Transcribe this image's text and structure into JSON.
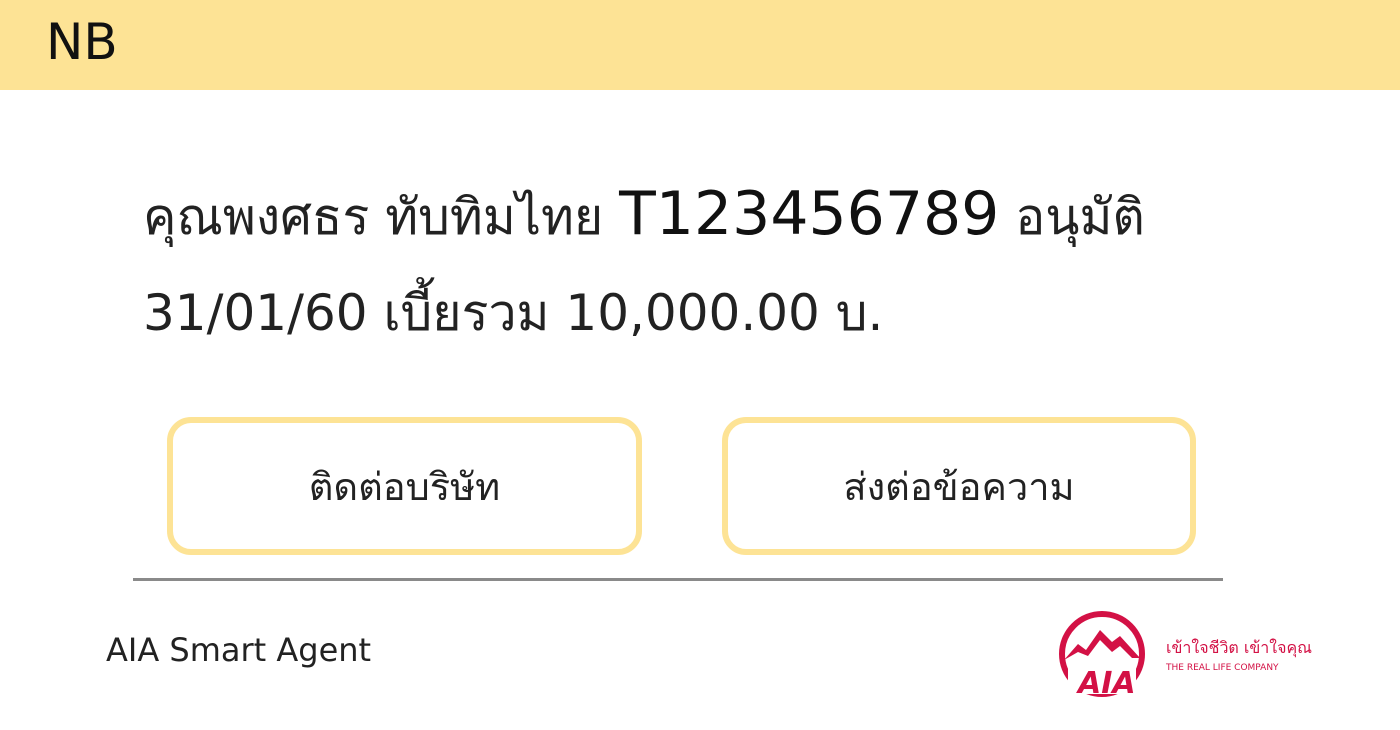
{
  "header": {
    "title": "NB"
  },
  "message": {
    "customer_name": "คุณพงศธร ทับทิมไทย",
    "policy_number": "T123456789",
    "status": "อนุมัติ",
    "date": "31/01/60",
    "premium_label": "เบี้ยรวม",
    "premium_amount": "10,000.00",
    "currency": "บ."
  },
  "actions": {
    "contact_label": "ติดต่อบริษัท",
    "forward_label": "ส่งต่อข้อความ"
  },
  "footer": {
    "app_name": "AIA Smart Agent",
    "logo_text": "AIA",
    "logo_tagline_th": "เข้าใจชีวิต เข้าใจคุณ",
    "logo_tagline_en": "THE REAL LIFE COMPANY"
  },
  "colors": {
    "header_bg": "#fde395",
    "button_border": "#fde395",
    "brand_red": "#d31145"
  }
}
